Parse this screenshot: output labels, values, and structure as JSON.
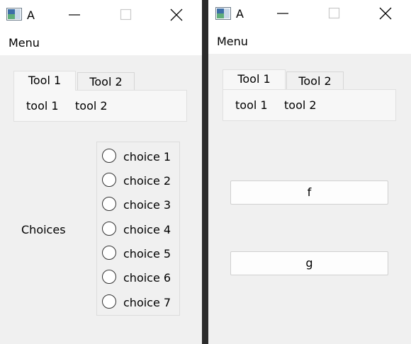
{
  "windows": [
    {
      "title": "A",
      "menu": [
        "Menu"
      ],
      "tabs": [
        {
          "label": "Tool 1",
          "active": true
        },
        {
          "label": "Tool 2",
          "active": false
        }
      ],
      "tools": [
        "tool 1",
        "tool 2"
      ],
      "choices_label": "Choices",
      "choices": [
        "choice 1",
        "choice 2",
        "choice 3",
        "choice 4",
        "choice 5",
        "choice 6",
        "choice 7"
      ]
    },
    {
      "title": "A",
      "menu": [
        "Menu"
      ],
      "tabs": [
        {
          "label": "Tool 1",
          "active": true
        },
        {
          "label": "Tool 2",
          "active": false
        }
      ],
      "tools": [
        "tool 1",
        "tool 2"
      ],
      "buttons": [
        "f",
        "g"
      ]
    }
  ],
  "icons": {
    "app": "app-icon",
    "minimize": "minimize-icon",
    "maximize": "maximize-icon",
    "close": "close-icon",
    "radio": "radio-unchecked-icon"
  }
}
